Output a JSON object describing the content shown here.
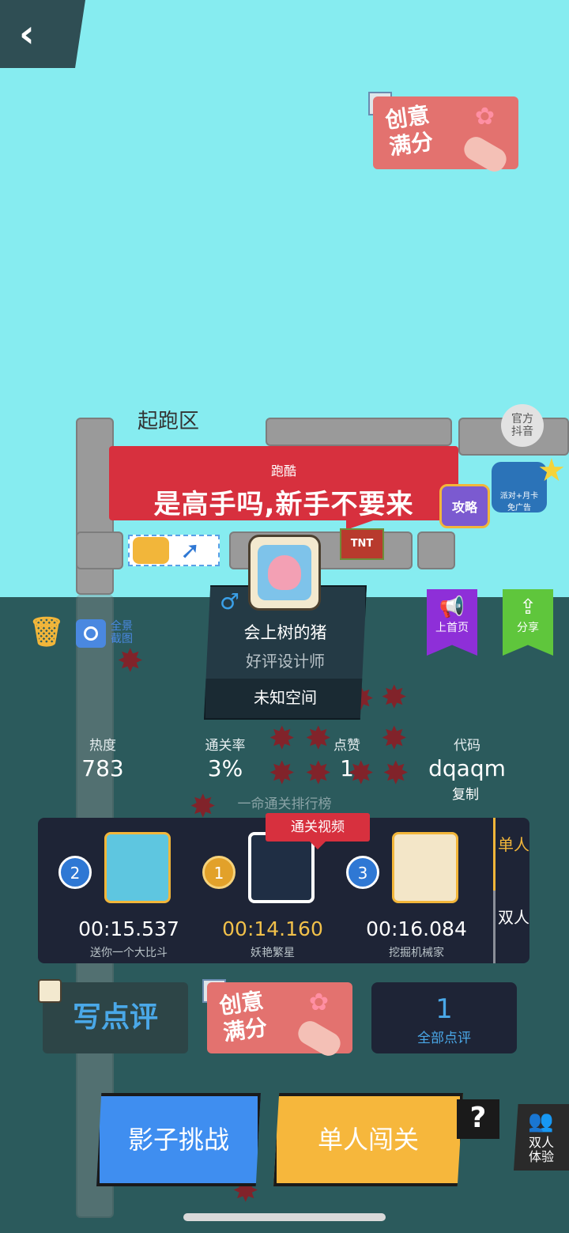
{
  "header": {
    "back_icon": "chevron-left-icon",
    "back_glyph": "‹"
  },
  "creative_badge": {
    "line1": "创意",
    "line2": "满分"
  },
  "level": {
    "start_zone_label": "起跑区",
    "official_douyin": {
      "line1": "官方",
      "line2": "抖音"
    },
    "banner": {
      "category": "跑酷",
      "title": "是高手吗,新手不要来"
    },
    "guide_tv_label": "攻略",
    "party_badge": {
      "line1": "派对+月卡",
      "line2": "免广告"
    },
    "tnt_label": "TNT"
  },
  "designer": {
    "gender_symbol": "♂",
    "name": "会上树的猪",
    "title": "好评设计师",
    "space": "未知空间"
  },
  "tools": {
    "trash_icon": "trash-icon",
    "screenshot_label_line1": "全景",
    "screenshot_label_line2": "截图"
  },
  "actions": {
    "promote": {
      "icon": "megaphone-icon",
      "label": "上首页",
      "color": "#8e2fd8"
    },
    "share": {
      "icon": "share-icon",
      "label": "分享",
      "color": "#5fc63c"
    }
  },
  "stats": {
    "heat": {
      "label": "热度",
      "value": "783"
    },
    "clear_rate": {
      "label": "通关率",
      "value": "3%"
    },
    "likes": {
      "label": "点赞",
      "value": "1"
    },
    "code": {
      "label": "代码",
      "value": "dqaqm",
      "copy": "复制"
    }
  },
  "leaderboard": {
    "caption": "一命通关排行榜",
    "video_tag": "通关视频",
    "tabs": {
      "single": "单人",
      "duo": "双人"
    },
    "entries": [
      {
        "rank": "2",
        "time": "00:15.537",
        "player": "送你一个大比斗"
      },
      {
        "rank": "1",
        "time": "00:14.160",
        "player": "妖艳繁星"
      },
      {
        "rank": "3",
        "time": "00:16.084",
        "player": "挖掘机械家"
      }
    ]
  },
  "reviews": {
    "write_label": "写点评",
    "count": "1",
    "all_label": "全部点评"
  },
  "bottom": {
    "shadow_challenge": "影子挑战",
    "solo_play": "单人闯关",
    "help": "?",
    "duo_label_line1": "双人",
    "duo_label_line2": "体验"
  },
  "colors": {
    "sky": "#86ecf0",
    "water": "#2b5a5c",
    "accent_red": "#d7303e",
    "gold": "#f2b63a",
    "blue_button": "#3f8ef0",
    "yellow_button": "#f6b73c"
  }
}
